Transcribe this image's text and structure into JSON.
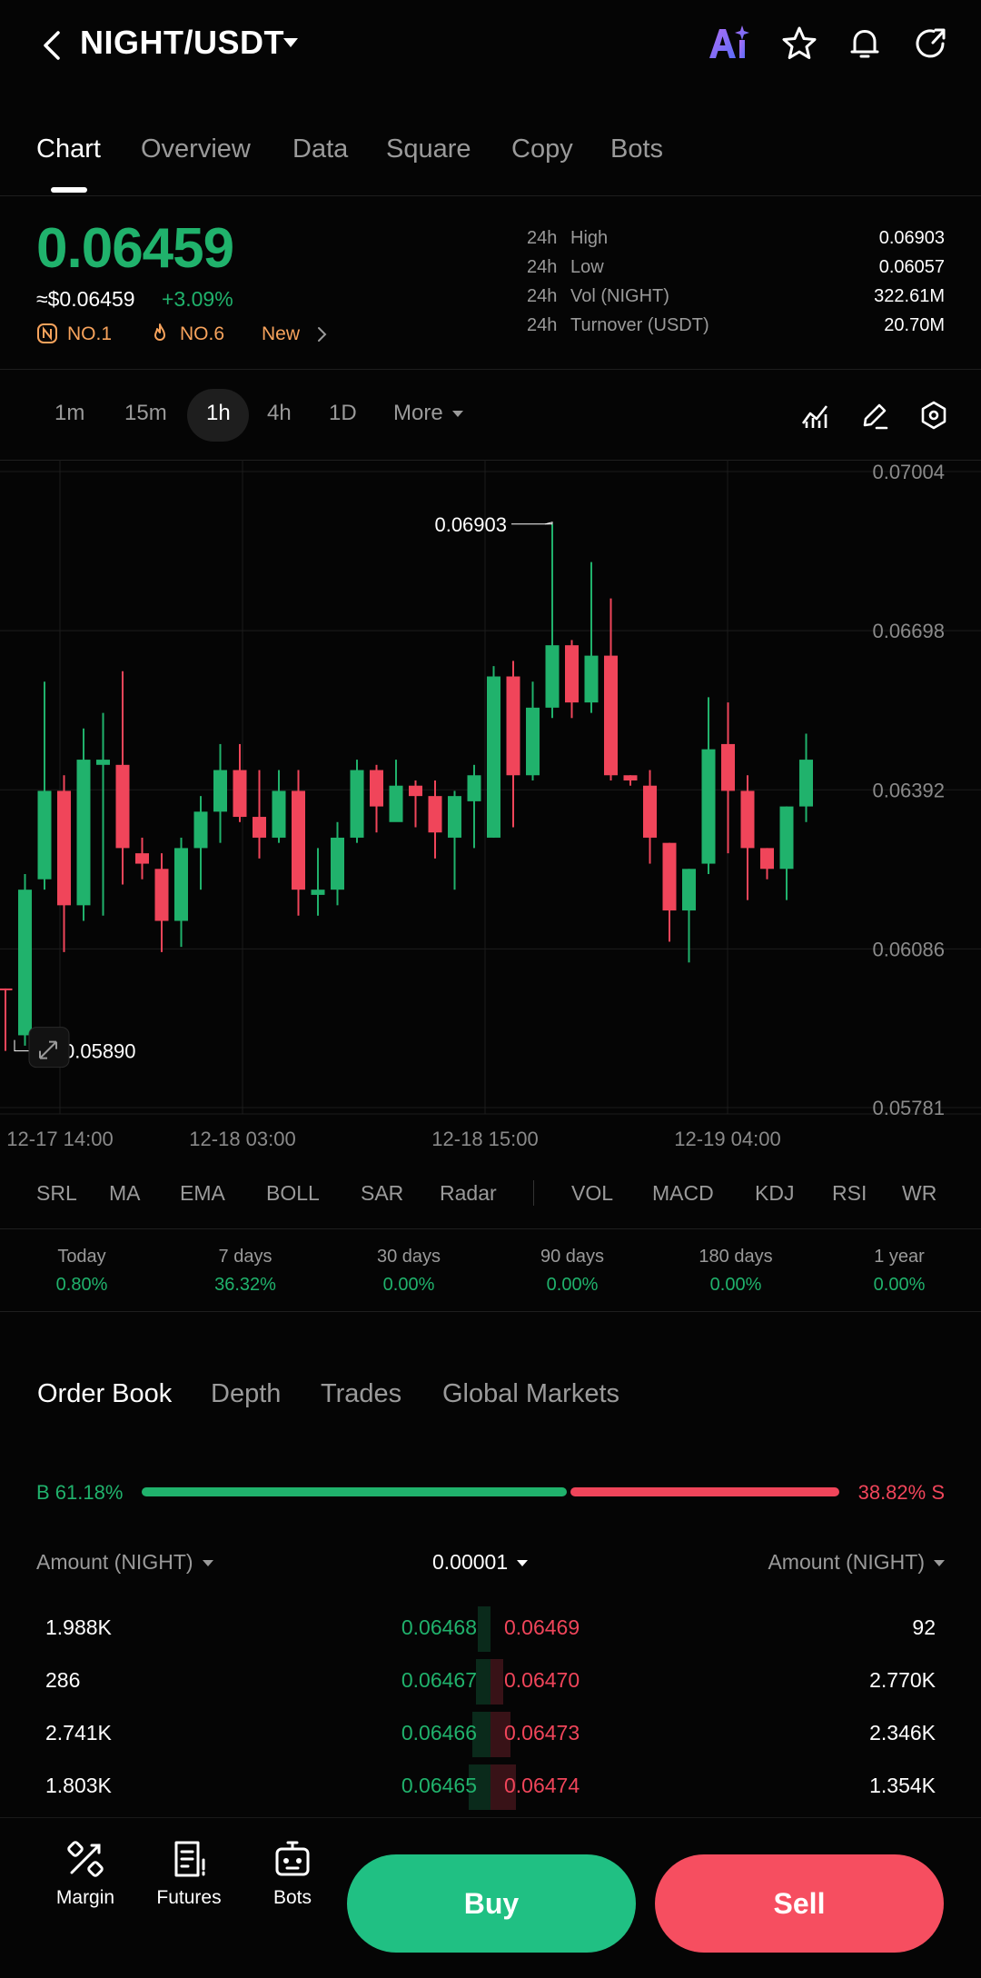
{
  "header": {
    "pair": "NIGHT/USDT",
    "ai_label": "AI"
  },
  "tabs": [
    "Chart",
    "Overview",
    "Data",
    "Square",
    "Copy",
    "Bots"
  ],
  "ticker": {
    "price": "0.06459",
    "usd_price": "≈$0.06459",
    "change": "+3.09%",
    "badges": [
      "NO.1",
      "NO.6",
      "New"
    ],
    "stats": [
      {
        "k1": "24h",
        "k2": "High",
        "v": "0.06903"
      },
      {
        "k1": "24h",
        "k2": "Low",
        "v": "0.06057"
      },
      {
        "k1": "24h",
        "k2": "Vol (NIGHT)",
        "v": "322.61M"
      },
      {
        "k1": "24h",
        "k2": "Turnover (USDT)",
        "v": "20.70M"
      }
    ]
  },
  "intervals": {
    "items": [
      "1m",
      "15m",
      "1h",
      "4h",
      "1D",
      "More"
    ],
    "selected": "1h"
  },
  "chart_data": {
    "type": "candlestick",
    "y_ticks": [
      "0.07004",
      "0.06698",
      "0.06392",
      "0.06086",
      "0.05781"
    ],
    "x_ticks": [
      "12-17 14:00",
      "12-18 03:00",
      "12-18 15:00",
      "12-19 04:00"
    ],
    "ylim": [
      0.05781,
      0.07004
    ],
    "max_label": "0.06903",
    "min_label": "0.05890",
    "up_color": "#20b26c",
    "down_color": "#f0455a",
    "candles": [
      {
        "o": 0.0601,
        "c": 0.0601,
        "h": 0.0601,
        "l": 0.0589,
        "d": 0
      },
      {
        "o": 0.0592,
        "c": 0.062,
        "h": 0.0623,
        "l": 0.059,
        "d": 1
      },
      {
        "o": 0.0622,
        "c": 0.0639,
        "h": 0.066,
        "l": 0.062,
        "d": 1
      },
      {
        "o": 0.0639,
        "c": 0.0617,
        "h": 0.0642,
        "l": 0.0608,
        "d": 0
      },
      {
        "o": 0.0617,
        "c": 0.0645,
        "h": 0.0651,
        "l": 0.0614,
        "d": 1
      },
      {
        "o": 0.0644,
        "c": 0.0645,
        "h": 0.0654,
        "l": 0.0615,
        "d": 1
      },
      {
        "o": 0.0644,
        "c": 0.0628,
        "h": 0.0662,
        "l": 0.0621,
        "d": 0
      },
      {
        "o": 0.0627,
        "c": 0.0625,
        "h": 0.063,
        "l": 0.0622,
        "d": 0
      },
      {
        "o": 0.0624,
        "c": 0.0614,
        "h": 0.0627,
        "l": 0.0608,
        "d": 0
      },
      {
        "o": 0.0614,
        "c": 0.0628,
        "h": 0.063,
        "l": 0.0609,
        "d": 1
      },
      {
        "o": 0.0628,
        "c": 0.0635,
        "h": 0.0638,
        "l": 0.062,
        "d": 1
      },
      {
        "o": 0.0635,
        "c": 0.0643,
        "h": 0.0648,
        "l": 0.0629,
        "d": 1
      },
      {
        "o": 0.0643,
        "c": 0.0634,
        "h": 0.0648,
        "l": 0.0633,
        "d": 0
      },
      {
        "o": 0.0634,
        "c": 0.063,
        "h": 0.0643,
        "l": 0.0626,
        "d": 0
      },
      {
        "o": 0.063,
        "c": 0.0639,
        "h": 0.0643,
        "l": 0.0629,
        "d": 1
      },
      {
        "o": 0.0639,
        "c": 0.062,
        "h": 0.0643,
        "l": 0.0615,
        "d": 0
      },
      {
        "o": 0.0619,
        "c": 0.062,
        "h": 0.0628,
        "l": 0.0615,
        "d": 1
      },
      {
        "o": 0.062,
        "c": 0.063,
        "h": 0.0633,
        "l": 0.0617,
        "d": 1
      },
      {
        "o": 0.063,
        "c": 0.0643,
        "h": 0.0645,
        "l": 0.0629,
        "d": 1
      },
      {
        "o": 0.0643,
        "c": 0.0636,
        "h": 0.0644,
        "l": 0.0631,
        "d": 0
      },
      {
        "o": 0.0633,
        "c": 0.064,
        "h": 0.0645,
        "l": 0.0635,
        "d": 1
      },
      {
        "o": 0.064,
        "c": 0.0638,
        "h": 0.0641,
        "l": 0.0632,
        "d": 0
      },
      {
        "o": 0.0638,
        "c": 0.0631,
        "h": 0.0641,
        "l": 0.0626,
        "d": 0
      },
      {
        "o": 0.063,
        "c": 0.0638,
        "h": 0.0639,
        "l": 0.062,
        "d": 1
      },
      {
        "o": 0.0637,
        "c": 0.0642,
        "h": 0.0644,
        "l": 0.0628,
        "d": 1
      },
      {
        "o": 0.063,
        "c": 0.0661,
        "h": 0.0663,
        "l": 0.063,
        "d": 1
      },
      {
        "o": 0.0661,
        "c": 0.0642,
        "h": 0.0664,
        "l": 0.0632,
        "d": 0
      },
      {
        "o": 0.0642,
        "c": 0.0655,
        "h": 0.066,
        "l": 0.0641,
        "d": 1
      },
      {
        "o": 0.0655,
        "c": 0.0667,
        "h": 0.06903,
        "l": 0.0653,
        "d": 1
      },
      {
        "o": 0.0667,
        "c": 0.0656,
        "h": 0.0668,
        "l": 0.0653,
        "d": 0
      },
      {
        "o": 0.0656,
        "c": 0.0665,
        "h": 0.0683,
        "l": 0.0654,
        "d": 1
      },
      {
        "o": 0.0665,
        "c": 0.0642,
        "h": 0.0676,
        "l": 0.0641,
        "d": 0
      },
      {
        "o": 0.0642,
        "c": 0.0641,
        "h": 0.0642,
        "l": 0.064,
        "d": 0
      },
      {
        "o": 0.064,
        "c": 0.063,
        "h": 0.0643,
        "l": 0.0625,
        "d": 0
      },
      {
        "o": 0.0629,
        "c": 0.0616,
        "h": 0.0629,
        "l": 0.061,
        "d": 0
      },
      {
        "o": 0.0616,
        "c": 0.0624,
        "h": 0.0624,
        "l": 0.0606,
        "d": 1
      },
      {
        "o": 0.0625,
        "c": 0.0647,
        "h": 0.0657,
        "l": 0.0623,
        "d": 1
      },
      {
        "o": 0.0648,
        "c": 0.0639,
        "h": 0.0656,
        "l": 0.0627,
        "d": 0
      },
      {
        "o": 0.0639,
        "c": 0.0628,
        "h": 0.0642,
        "l": 0.0618,
        "d": 0
      },
      {
        "o": 0.0628,
        "c": 0.0624,
        "h": 0.0628,
        "l": 0.0622,
        "d": 0
      },
      {
        "o": 0.0624,
        "c": 0.0636,
        "h": 0.0636,
        "l": 0.0618,
        "d": 1
      },
      {
        "o": 0.0636,
        "c": 0.0645,
        "h": 0.065,
        "l": 0.0633,
        "d": 1
      }
    ]
  },
  "indicators": [
    "SRL",
    "MA",
    "EMA",
    "BOLL",
    "SAR",
    "Radar",
    "VOL",
    "MACD",
    "KDJ",
    "RSI",
    "WR"
  ],
  "performance": [
    {
      "label": "Today",
      "value": "0.80%"
    },
    {
      "label": "7 days",
      "value": "36.32%"
    },
    {
      "label": "30 days",
      "value": "0.00%"
    },
    {
      "label": "90 days",
      "value": "0.00%"
    },
    {
      "label": "180 days",
      "value": "0.00%"
    },
    {
      "label": "1 year",
      "value": "0.00%"
    }
  ],
  "orderbook": {
    "tabs": [
      "Order Book",
      "Depth",
      "Trades",
      "Global Markets"
    ],
    "buy_ratio": "B 61.18%",
    "sell_ratio": "38.82% S",
    "buy_fraction": 0.6118,
    "col_left": "Amount (NIGHT)",
    "precision": "0.00001",
    "col_right": "Amount (NIGHT)",
    "rows": [
      {
        "bid_amt": "1.988K",
        "bid_px": "0.06468",
        "ask_px": "0.06469",
        "ask_amt": "92"
      },
      {
        "bid_amt": "286",
        "bid_px": "0.06467",
        "ask_px": "0.06470",
        "ask_amt": "2.770K"
      },
      {
        "bid_amt": "2.741K",
        "bid_px": "0.06466",
        "ask_px": "0.06473",
        "ask_amt": "2.346K"
      },
      {
        "bid_amt": "1.803K",
        "bid_px": "0.06465",
        "ask_px": "0.06474",
        "ask_amt": "1.354K"
      }
    ]
  },
  "bottom_nav": {
    "margin": "Margin",
    "futures": "Futures",
    "bots": "Bots",
    "buy": "Buy",
    "sell": "Sell"
  }
}
